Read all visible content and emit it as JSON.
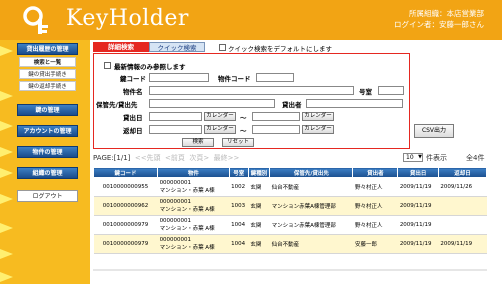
{
  "header": {
    "brand": "KeyHolder",
    "user_line1": "所属組織：本店営業部",
    "user_line2": "ログイン者：安藤一郎さん",
    "colors": {
      "bar": "#f2a414",
      "logo": "#ffffff"
    }
  },
  "sidebar": {
    "lending_head": "貸出履歴の管理",
    "lending_items": [
      "検索と一覧",
      "鍵の貸出手続き",
      "鍵の返却手続き"
    ],
    "key_head": "鍵の管理",
    "account_head": "アカウントの管理",
    "property_head": "物件の管理",
    "org_head": "組織の管理",
    "logout": "ログアウト"
  },
  "tabs": {
    "detail": "詳細検索",
    "quick": "クイック検索",
    "default_label": "クイック検索をデフォルトにします"
  },
  "search": {
    "latest_only": "最新情報のみ参照します",
    "key_code": "鍵コード",
    "property_code": "物件コード",
    "property_name": "物件名",
    "room_no": "号室",
    "lender": "保管先/貸出先",
    "borrower": "貸出者",
    "lent_date": "貸出日",
    "return_date": "返却日",
    "calendar": "カレンダー",
    "tilde": "～",
    "search_btn": "検索",
    "reset_btn": "リセット",
    "csv_btn": "CSV出力"
  },
  "pager": {
    "page": "PAGE:[1/1]",
    "first": "<<先頭",
    "prev": "<前頁",
    "next": "次頁>",
    "last": "最終>>",
    "per_page": "10",
    "per_page_label": "件表示",
    "total": "全4件"
  },
  "table": {
    "headers": [
      "鍵コード",
      "物件",
      "号室",
      "鍵種別",
      "保管先/貸出先",
      "貸出者",
      "貸出日",
      "返却日"
    ],
    "rows": [
      {
        "code": "0010000000955",
        "prop_code": "000000001",
        "prop_name": "マンション・赤葉 A棟",
        "room": "1002",
        "type": "玄関",
        "lender": "仙台不動産",
        "borrower": "野々村正人",
        "lent": "2009/11/19",
        "ret": "2009/11/26"
      },
      {
        "code": "0010000000962",
        "prop_code": "000000001",
        "prop_name": "マンション・赤葉 A棟",
        "room": "1003",
        "type": "玄関",
        "lender": "マンション赤葉A棟管理部",
        "borrower": "野々村正人",
        "lent": "2009/11/19",
        "ret": ""
      },
      {
        "code": "0010000000979",
        "prop_code": "000000001",
        "prop_name": "マンション・赤葉 A棟",
        "room": "1004",
        "type": "玄関",
        "lender": "マンション赤葉A棟管理部",
        "borrower": "野々村正人",
        "lent": "2009/11/19",
        "ret": ""
      },
      {
        "code": "0010000000979",
        "prop_code": "000000001",
        "prop_name": "マンション・赤葉 A棟",
        "room": "1004",
        "type": "玄関",
        "lender": "仙台不動産",
        "borrower": "安藤一郎",
        "lent": "2009/11/19",
        "ret": "2009/11/19"
      }
    ]
  }
}
